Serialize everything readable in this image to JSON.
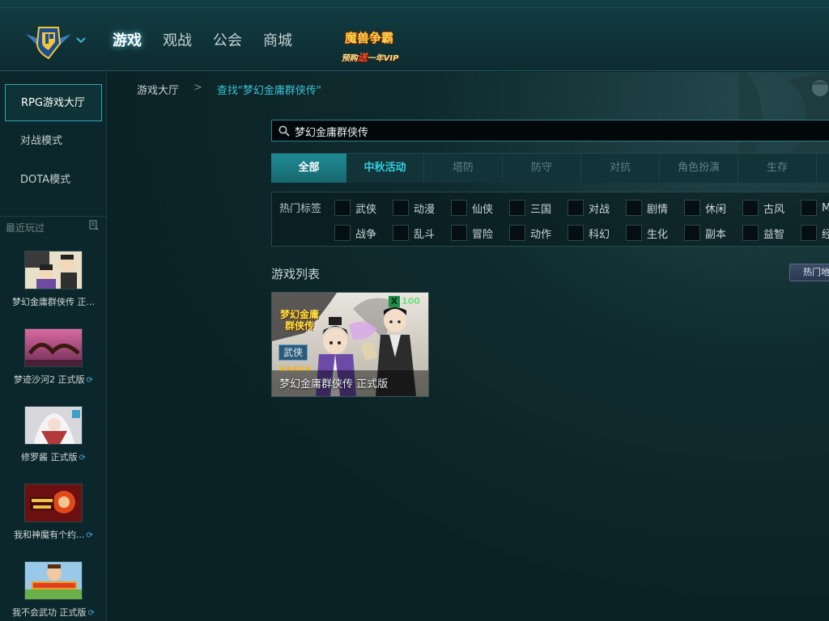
{
  "topbar": {
    "nav": [
      {
        "label": "游戏",
        "active": true
      },
      {
        "label": "观战",
        "active": false
      },
      {
        "label": "公会",
        "active": false
      },
      {
        "label": "商城",
        "active": false
      }
    ],
    "promo": {
      "title": "魔兽争霸",
      "sub_prefix": "预购",
      "sub_highlight": "送",
      "sub_suffix": "一年VIP"
    }
  },
  "sidebar": {
    "buttons": [
      {
        "label": "RPG游戏大厅",
        "active": true
      },
      {
        "label": "对战模式",
        "active": false
      },
      {
        "label": "DOTA模式",
        "active": false
      }
    ],
    "recent_title": "最近玩过",
    "recent": [
      {
        "label": "梦幻金庸群侠传 正...",
        "spin": false
      },
      {
        "label": "梦迹沙河2 正式版",
        "spin": true
      },
      {
        "label": "修罗酱 正式版",
        "spin": true
      },
      {
        "label": "我和神魔有个约...",
        "spin": true
      },
      {
        "label": "我不会武功 正式版",
        "spin": true
      }
    ]
  },
  "main": {
    "breadcrumb": {
      "home": "游戏大厅",
      "separator": ">",
      "current": "查找\"梦幻金庸群侠传\""
    },
    "search": {
      "value": "梦幻金庸群侠传"
    },
    "tabs": [
      {
        "label": "全部",
        "state": "active"
      },
      {
        "label": "中秋活动",
        "state": "event"
      },
      {
        "label": "塔防",
        "state": ""
      },
      {
        "label": "防守",
        "state": ""
      },
      {
        "label": "对抗",
        "state": ""
      },
      {
        "label": "角色扮演",
        "state": ""
      },
      {
        "label": "生存",
        "state": ""
      }
    ],
    "tags": {
      "heading": "热门标签",
      "row1": [
        "武侠",
        "动漫",
        "仙侠",
        "三国",
        "对战",
        "剧情",
        "休闲",
        "古风",
        "M"
      ],
      "row2": [
        "战争",
        "乱斗",
        "冒险",
        "动作",
        "科幻",
        "生化",
        "副本",
        "益智",
        "经"
      ]
    },
    "list_title": "游戏列表",
    "sort_label": "热门地图",
    "cards": [
      {
        "name": "梦幻金庸群侠传 正式版",
        "cover_title_1": "梦幻金庸",
        "cover_title_2": "群侠传",
        "badge": "武侠",
        "stars": "★★★★★",
        "count": "100",
        "x_mark": "X"
      }
    ]
  },
  "colors": {
    "accent": "#2ba8b4",
    "link": "#39c3d4",
    "event_tab": "#2fd0e0",
    "background": "#0b2226"
  },
  "icons": [
    "brand-logo-icon",
    "chevron-down-icon",
    "search-icon",
    "list-icon",
    "refresh-icon"
  ]
}
